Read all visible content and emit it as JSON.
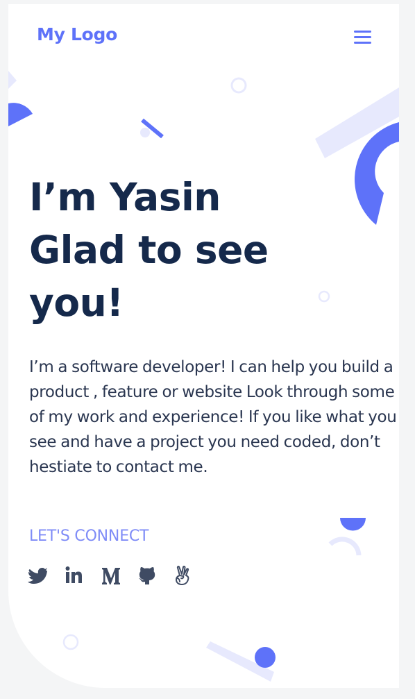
{
  "header": {
    "logo": "My Logo",
    "menu_icon": "hamburger-menu-icon"
  },
  "hero": {
    "title_lines": [
      "I’m Yasin",
      "Glad to see",
      "you!"
    ],
    "description": "I’m a software developer! I can help you build a product , feature or website Look through some of my work and experience! If you like what you see and have a project you need coded, don’t hestiate to contact me.",
    "connect_label": "LET'S CONNECT"
  },
  "social_icons": [
    "twitter-icon",
    "linkedin-icon",
    "medium-icon",
    "github-icon",
    "angellist-icon"
  ],
  "colors": {
    "accent": "#5e72f9",
    "accent_light": "#e7e9fd",
    "heading": "#15294b",
    "body_text": "#2a3650",
    "link": "#7f8cf7",
    "icon": "#3f4b63",
    "background": "#f4f5f6"
  }
}
